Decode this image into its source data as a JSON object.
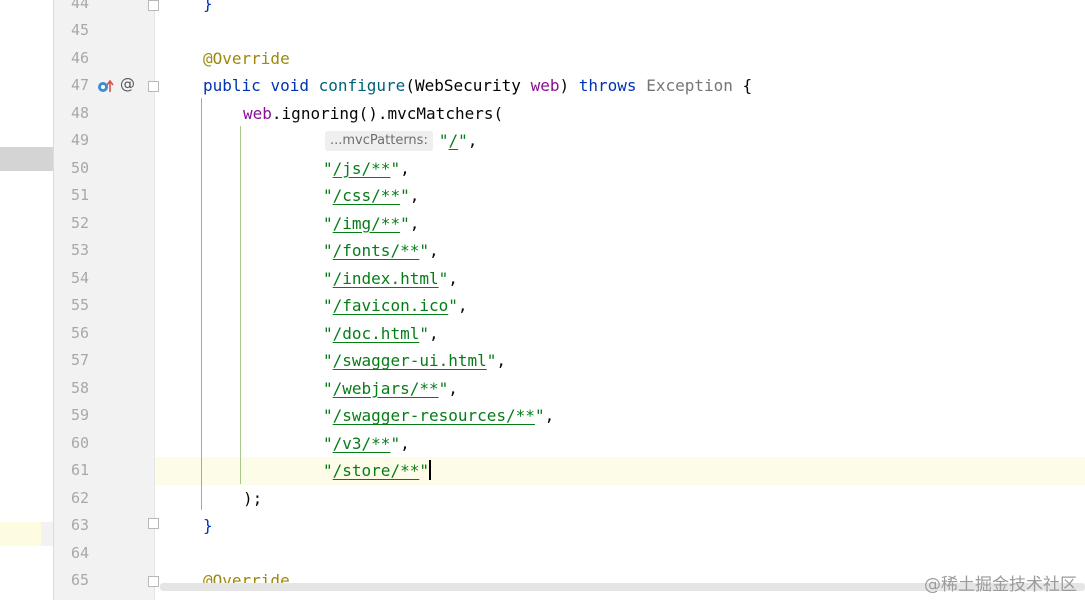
{
  "editor": {
    "lines": [
      {
        "num": "44",
        "type": "brace",
        "text": "}"
      },
      {
        "num": "45",
        "type": "empty"
      },
      {
        "num": "46",
        "type": "annotation",
        "text": "@Override"
      },
      {
        "num": "47",
        "type": "signature",
        "kw1": "public",
        "kw2": "void",
        "method": "configure",
        "paren_open": "(",
        "param_type": "WebSecurity",
        "param_name": "web",
        "paren_close": ")",
        "kw3": "throws",
        "exception": "Exception",
        "brace": "{"
      },
      {
        "num": "48",
        "type": "call",
        "obj": "web",
        "dot1": ".",
        "m1": "ignoring",
        "p1": "()",
        "dot2": ".",
        "m2": "mvcMatchers",
        "p2": "("
      },
      {
        "num": "49",
        "type": "first_arg",
        "hint": "...mvcPatterns:",
        "q1": "\"",
        "path": "/",
        "q2": "\"",
        "sep": ","
      },
      {
        "num": "50",
        "type": "arg",
        "q1": "\"",
        "path": "/js/**",
        "q2": "\"",
        "sep": ","
      },
      {
        "num": "51",
        "type": "arg",
        "q1": "\"",
        "path": "/css/**",
        "q2": "\"",
        "sep": ","
      },
      {
        "num": "52",
        "type": "arg",
        "q1": "\"",
        "path": "/img/**",
        "q2": "\"",
        "sep": ","
      },
      {
        "num": "53",
        "type": "arg",
        "q1": "\"",
        "path": "/fonts/**",
        "q2": "\"",
        "sep": ","
      },
      {
        "num": "54",
        "type": "arg",
        "q1": "\"",
        "path": "/index.html",
        "q2": "\"",
        "sep": ","
      },
      {
        "num": "55",
        "type": "arg",
        "q1": "\"",
        "path": "/favicon.ico",
        "q2": "\"",
        "sep": ","
      },
      {
        "num": "56",
        "type": "arg",
        "q1": "\"",
        "path": "/doc.html",
        "q2": "\"",
        "sep": ","
      },
      {
        "num": "57",
        "type": "arg",
        "q1": "\"",
        "path": "/swagger-ui.html",
        "q2": "\"",
        "sep": ","
      },
      {
        "num": "58",
        "type": "arg",
        "q1": "\"",
        "path": "/webjars/**",
        "q2": "\"",
        "sep": ","
      },
      {
        "num": "59",
        "type": "arg",
        "q1": "\"",
        "path": "/swagger-resources/**",
        "q2": "\"",
        "sep": ","
      },
      {
        "num": "60",
        "type": "arg",
        "q1": "\"",
        "path": "/v3/**",
        "q2": "\"",
        "sep": ","
      },
      {
        "num": "61",
        "type": "arg_last",
        "q1": "\"",
        "path": "/store/**",
        "q2": "\""
      },
      {
        "num": "62",
        "type": "close_call",
        "text": ");"
      },
      {
        "num": "63",
        "type": "brace_end",
        "text": "}"
      },
      {
        "num": "64",
        "type": "empty"
      },
      {
        "num": "65",
        "type": "annotation",
        "text": "@Override"
      }
    ],
    "current_line": "61"
  },
  "gutter_icons": {
    "override_marker": "override-up-arrow-icon",
    "at_symbol": "@"
  },
  "watermark": "@稀土掘金技术社区",
  "colors": {
    "keyword": "#0033b3",
    "annotation": "#9e880d",
    "method": "#00627a",
    "variable": "#871094",
    "string": "#067d17",
    "line_number": "#a8a8a8",
    "current_line_bg": "#fdfce8"
  }
}
